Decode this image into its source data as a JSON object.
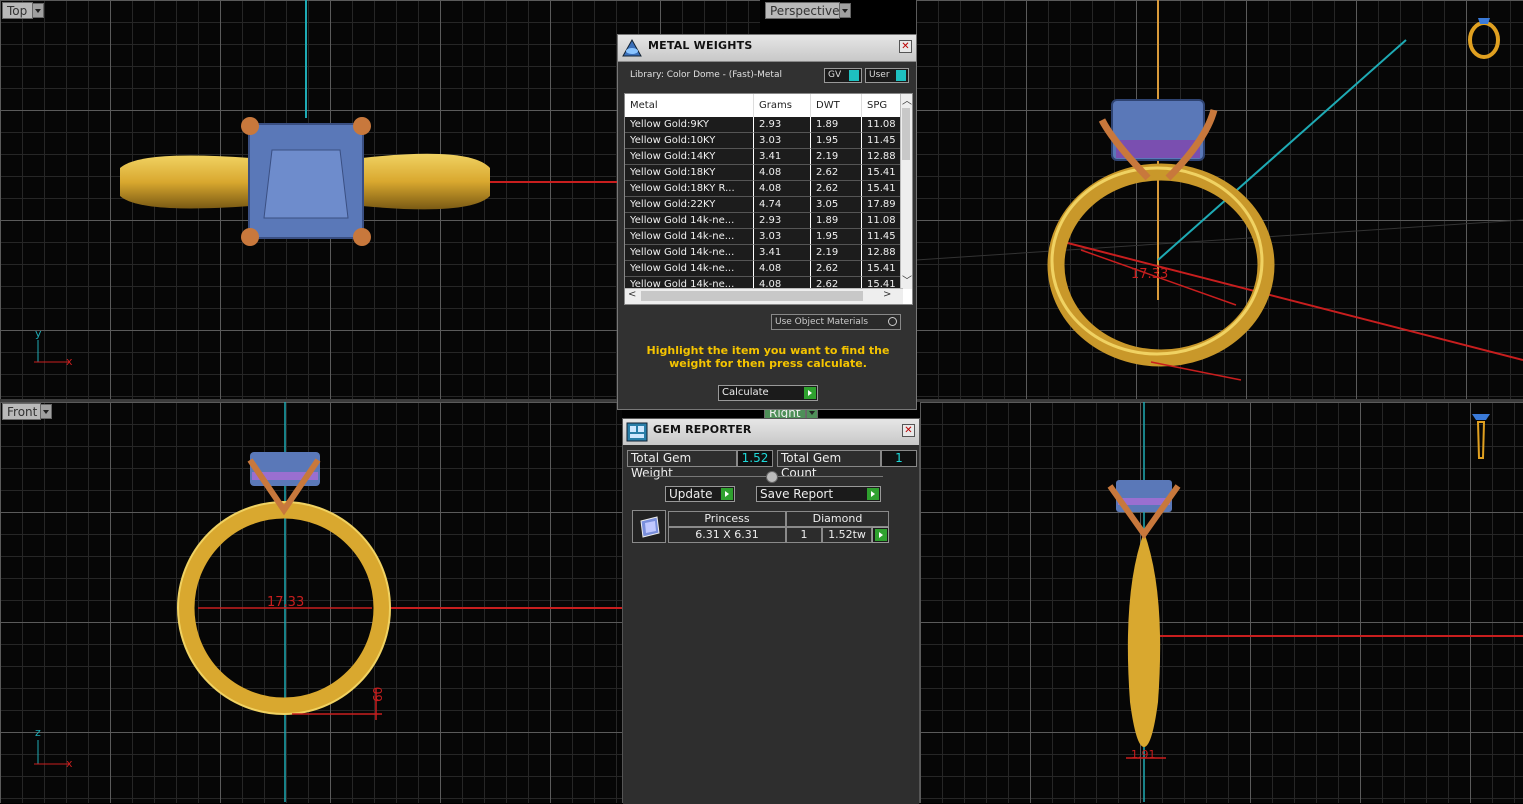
{
  "viewports": {
    "top": {
      "label": "Top"
    },
    "perspective": {
      "label": "Perspective"
    },
    "front": {
      "label": "Front"
    },
    "right": {
      "label": "Right"
    },
    "dims": {
      "ring_size": "17.33",
      "band_depth": "60",
      "band_width": "1.91"
    },
    "axes": {
      "y": "y",
      "x": "x",
      "z": "z"
    }
  },
  "metal_weights": {
    "title": "METAL WEIGHTS",
    "library": "Library: Color Dome - (Fast)-Metal",
    "toggle_gv": "GV",
    "toggle_user": "User",
    "columns": [
      "Metal",
      "Grams",
      "DWT",
      "SPG"
    ],
    "rows": [
      [
        "Yellow Gold:9KY",
        "2.93",
        "1.89",
        "11.08"
      ],
      [
        "Yellow Gold:10KY",
        "3.03",
        "1.95",
        "11.45"
      ],
      [
        "Yellow Gold:14KY",
        "3.41",
        "2.19",
        "12.88"
      ],
      [
        "Yellow Gold:18KY",
        "4.08",
        "2.62",
        "15.41"
      ],
      [
        "Yellow Gold:18KY R...",
        "4.08",
        "2.62",
        "15.41"
      ],
      [
        "Yellow Gold:22KY",
        "4.74",
        "3.05",
        "17.89"
      ],
      [
        "Yellow Gold 14k-ne...",
        "2.93",
        "1.89",
        "11.08"
      ],
      [
        "Yellow Gold 14k-ne...",
        "3.03",
        "1.95",
        "11.45"
      ],
      [
        "Yellow Gold 14k-ne...",
        "3.41",
        "2.19",
        "12.88"
      ],
      [
        "Yellow Gold 14k-ne...",
        "4.08",
        "2.62",
        "15.41"
      ],
      [
        "Yellow Gold 14k-ne...",
        "4.08",
        "2.62",
        "15.41"
      ]
    ],
    "use_object_materials": "Use Object Materials",
    "hint": "Highlight the item you want to find the weight for then press calculate.",
    "calculate_label": "Calculate"
  },
  "gem_reporter": {
    "title": "GEM REPORTER",
    "total_weight_label": "Total Gem Weight",
    "total_weight": "1.52",
    "total_count_label": "Total Gem Count",
    "total_count": "1",
    "update_label": "Update",
    "save_report_label": "Save Report",
    "gem": {
      "cut": "Princess",
      "type": "Diamond",
      "size": "6.31 X 6.31",
      "qty": "1",
      "weight": "1.52tw"
    }
  },
  "colors": {
    "gold": "#d9a82f",
    "gem": "#5a78b8",
    "prong": "#c8783c",
    "axis_red": "#c81e1e",
    "axis_cyan": "#1eaab4",
    "hint_yellow": "#f5c400",
    "accent_green": "#2fa12f"
  }
}
